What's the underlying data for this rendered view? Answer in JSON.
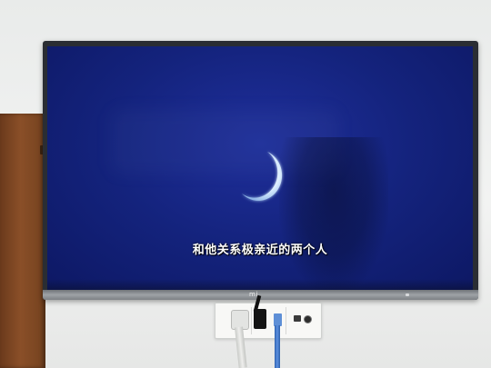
{
  "tv": {
    "subtitle": "和他关系极亲近的两个人",
    "brand_logo": "mi"
  },
  "scene": {
    "screen_color": "#14237d",
    "moon_color": "#d9ecff",
    "icons": [
      "crescent-moon-icon"
    ]
  }
}
